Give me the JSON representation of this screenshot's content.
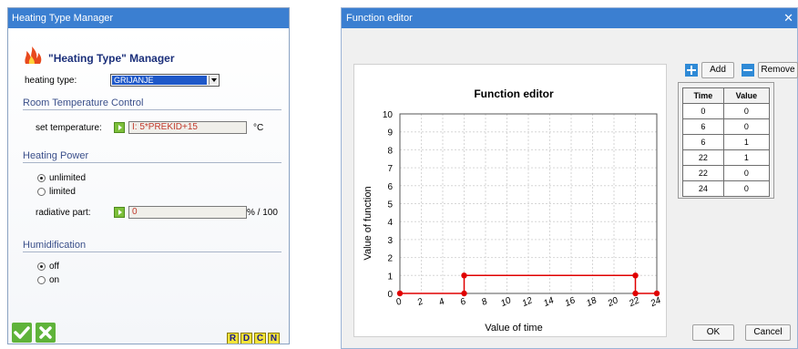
{
  "manager": {
    "window_title": "Heating Type Manager",
    "heading": "\"Heating Type\" Manager",
    "heating_type_label": "heating type:",
    "heating_type_value": "GRIJANJE",
    "room_section": "Room Temperature Control",
    "set_temp_label": "set temperature:",
    "set_temp_value": "I: 5*PREKID+15",
    "set_temp_unit": "°C",
    "power_section": "Heating Power",
    "power_opt_unlimited": "unlimited",
    "power_opt_limited": "limited",
    "power_selected": "unlimited",
    "radiative_label": "radiative part:",
    "radiative_value": "0",
    "radiative_unit": "% / 100",
    "humid_section": "Humidification",
    "humid_opt_off": "off",
    "humid_opt_on": "on",
    "humid_selected": "off",
    "letter_buttons": [
      "R",
      "D",
      "C",
      "N"
    ]
  },
  "editor": {
    "window_title": "Function editor",
    "add_label": "Add",
    "remove_label": "Remove",
    "table_headers": [
      "Time",
      "Value"
    ],
    "table_rows": [
      [
        "0",
        "0"
      ],
      [
        "6",
        "0"
      ],
      [
        "6",
        "1"
      ],
      [
        "22",
        "1"
      ],
      [
        "22",
        "0"
      ],
      [
        "24",
        "0"
      ]
    ],
    "ok_label": "OK",
    "cancel_label": "Cancel"
  },
  "chart_data": {
    "type": "line",
    "title": "Function editor",
    "xlabel": "Value of time",
    "ylabel": "Value of function",
    "xlim": [
      0,
      24
    ],
    "ylim": [
      0,
      10
    ],
    "x_ticks": [
      "0",
      "2",
      "4",
      "6",
      "8",
      "10",
      "12",
      "14",
      "16",
      "18",
      "20",
      "22",
      "24"
    ],
    "y_ticks": [
      "0",
      "1",
      "2",
      "3",
      "4",
      "5",
      "6",
      "7",
      "8",
      "9",
      "10"
    ],
    "grid": true,
    "series": [
      {
        "x": [
          0,
          6,
          6,
          22,
          22,
          24
        ],
        "y": [
          0,
          0,
          1,
          1,
          0,
          0
        ],
        "color": "#e00000"
      }
    ]
  },
  "colors": {
    "titlebar": "#3b7fd1",
    "accent_green": "#5fb33a",
    "line_red": "#e00000"
  }
}
